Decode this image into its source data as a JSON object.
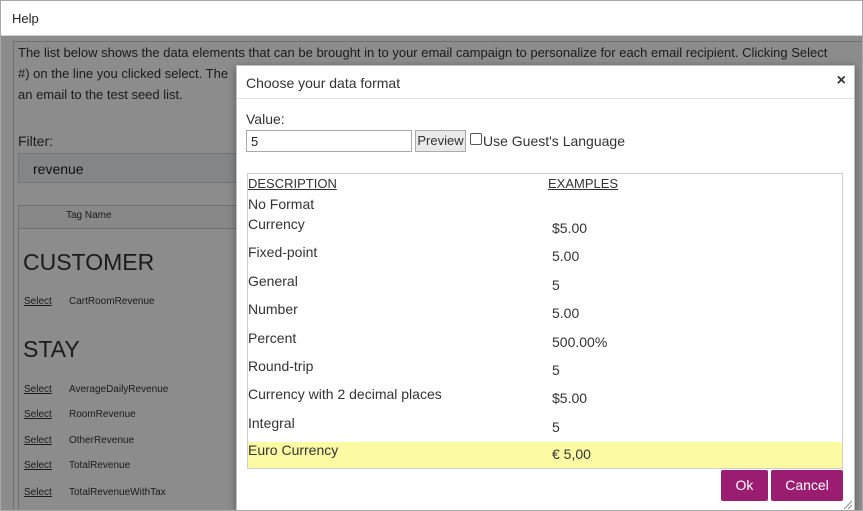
{
  "help_bar": {
    "title": "Help"
  },
  "background": {
    "intro_lines": [
      "The list below shows the data elements that can be brought in to your email campaign to personalize for each email recipient. Clicking Select",
      "#) on the line you clicked select. The                                        ",
      "an email to the test seed list."
    ],
    "filter_label": "Filter:",
    "filter_value": "revenue",
    "table_header": "Tag Name",
    "groups": [
      {
        "name": "CUSTOMER",
        "rows": [
          {
            "select": "Select",
            "tag": "CartRoomRevenue"
          }
        ]
      },
      {
        "name": "STAY",
        "rows": [
          {
            "select": "Select",
            "tag": "AverageDailyRevenue"
          },
          {
            "select": "Select",
            "tag": "RoomRevenue"
          },
          {
            "select": "Select",
            "tag": "OtherRevenue"
          },
          {
            "select": "Select",
            "tag": "TotalRevenue"
          },
          {
            "select": "Select",
            "tag": "TotalRevenueWithTax"
          }
        ]
      }
    ]
  },
  "dialog": {
    "title": "Choose your data format",
    "close_icon": "close-icon",
    "value_label": "Value:",
    "value": "5",
    "preview_label": "Preview",
    "guest_language_label": "Use Guest's Language",
    "guest_language_checked": false,
    "columns": {
      "description": "DESCRIPTION",
      "examples": "EXAMPLES"
    },
    "formats": [
      {
        "description": "No Format",
        "example": ""
      },
      {
        "description": "Currency",
        "example": "$5.00"
      },
      {
        "description": "Fixed-point",
        "example": "5.00"
      },
      {
        "description": "General",
        "example": "5"
      },
      {
        "description": "Number",
        "example": "5.00"
      },
      {
        "description": "Percent",
        "example": "500.00%"
      },
      {
        "description": "Round-trip",
        "example": "5"
      },
      {
        "description": "Currency with 2 decimal places",
        "example": "$5.00"
      },
      {
        "description": "Integral",
        "example": "5"
      },
      {
        "description": "Euro Currency",
        "example": "€ 5,00",
        "selected": true
      }
    ],
    "ok_label": "Ok",
    "cancel_label": "Cancel",
    "accent_color": "#9b1d72",
    "selected_row_color": "#fdfaa4"
  }
}
